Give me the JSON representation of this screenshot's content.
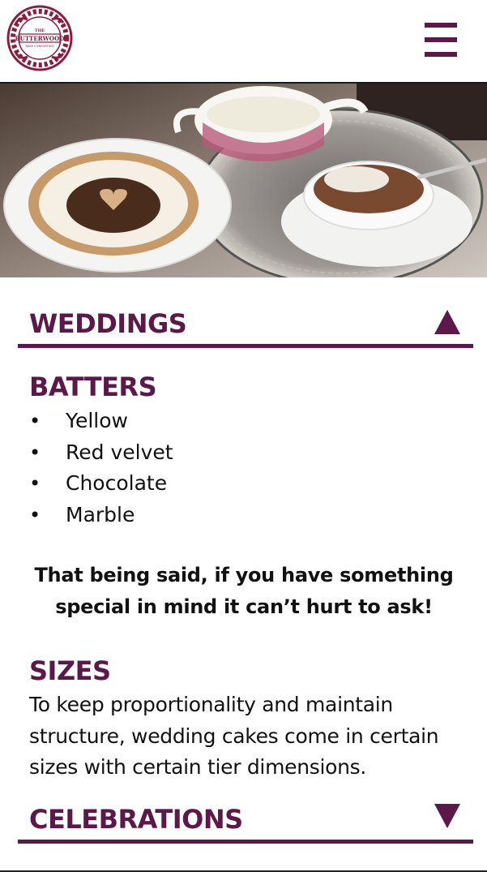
{
  "header": {
    "logo": {
      "line1": "THE",
      "line2": "BUTTERWOOD",
      "line3": "BAKE CONSORTIUM"
    },
    "menu_icon": "hamburger-menu-icon"
  },
  "hero": {
    "description_icon": "cake-and-tea-photo"
  },
  "weddings": {
    "title": "WEDDINGS",
    "toggle_icon": "triangle-up-icon",
    "batters": {
      "heading": "BATTERS",
      "items": [
        "Yellow",
        "Red velvet",
        "Chocolate",
        "Marble"
      ]
    },
    "note": "That being said, if you have something special in mind it can’t hurt to ask!",
    "sizes": {
      "heading": "SIZES",
      "text": "To keep proportionality and maintain structure, wedding cakes come in certain sizes with certain tier dimensions."
    }
  },
  "celebrations": {
    "title": "CELEBRATIONS",
    "toggle_icon": "triangle-down-icon"
  },
  "colors": {
    "accent": "#5c1848",
    "text": "#111111",
    "background": "#ffffff"
  }
}
